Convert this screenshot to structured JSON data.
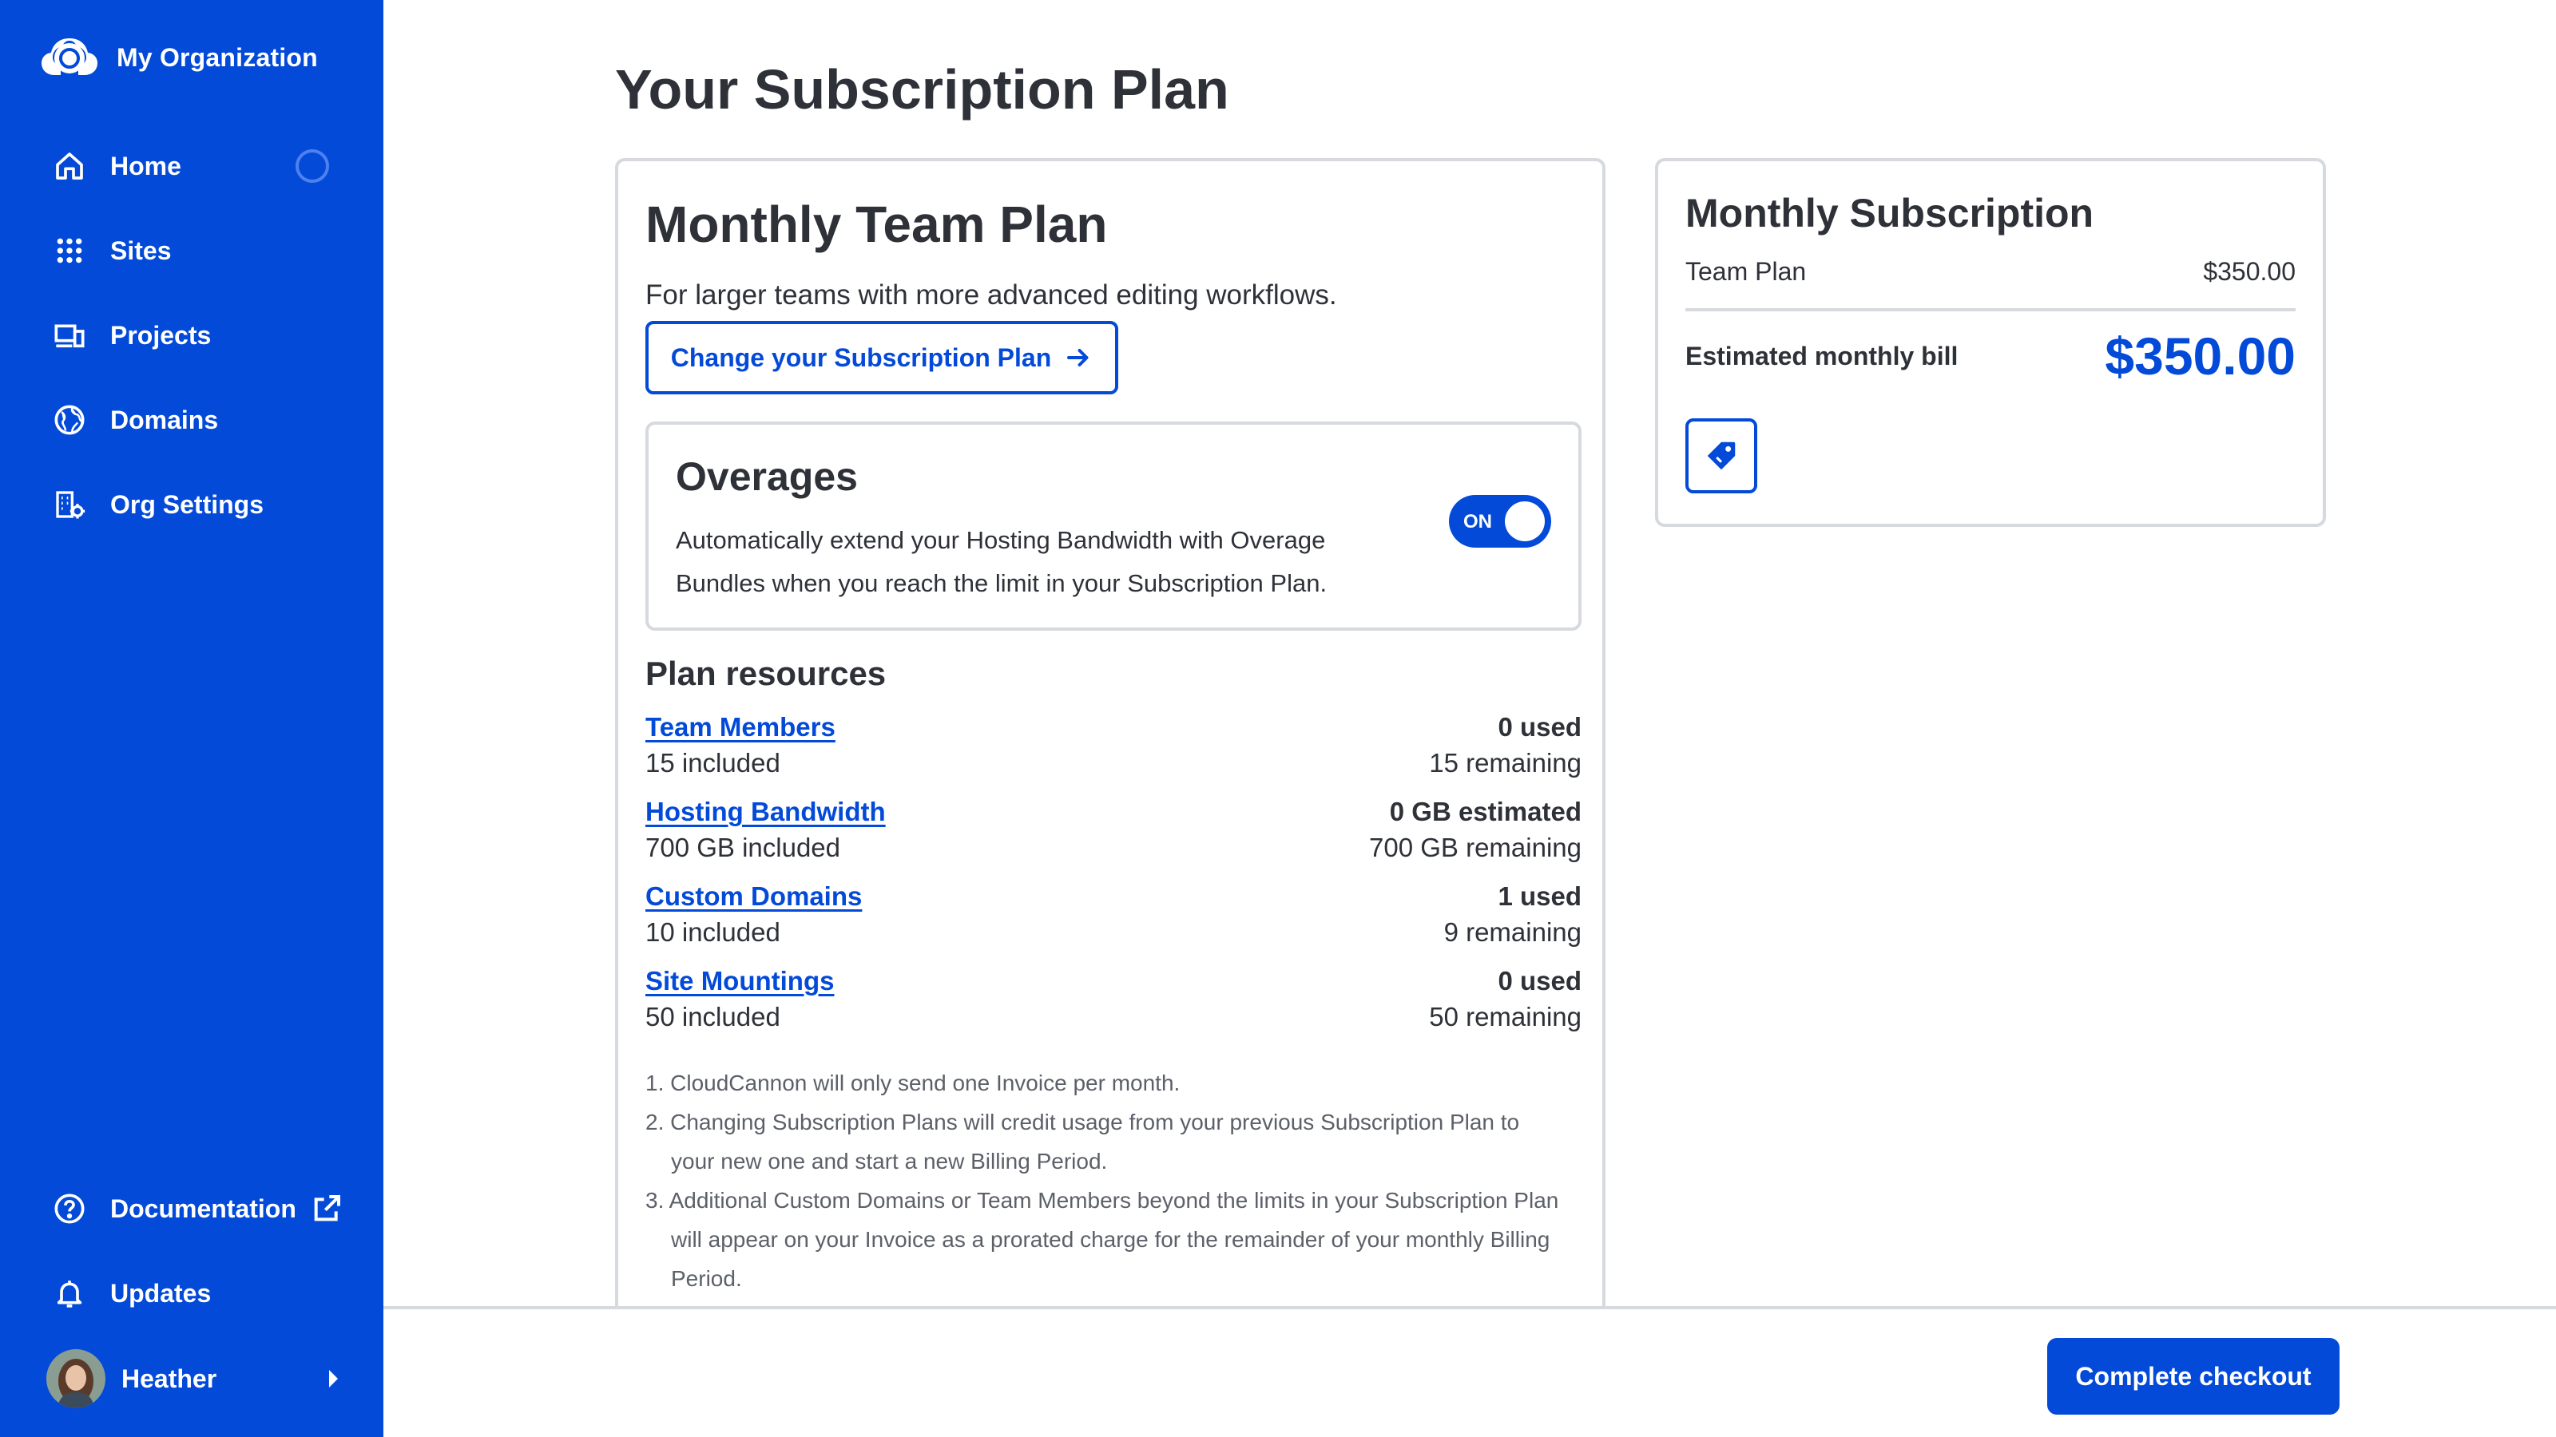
{
  "sidebar": {
    "org_name": "My Organization",
    "items": [
      {
        "label": "Home",
        "icon": "home-icon"
      },
      {
        "label": "Sites",
        "icon": "grid-icon"
      },
      {
        "label": "Projects",
        "icon": "devices-icon"
      },
      {
        "label": "Domains",
        "icon": "globe-icon"
      },
      {
        "label": "Org Settings",
        "icon": "building-gear-icon"
      }
    ],
    "bottom_items": [
      {
        "label": "Documentation",
        "icon": "help-circle-icon"
      },
      {
        "label": "Updates",
        "icon": "bell-icon"
      }
    ],
    "user": {
      "name": "Heather"
    },
    "accent": "#034ad8"
  },
  "page": {
    "title": "Your Subscription Plan"
  },
  "plan": {
    "name": "Monthly Team Plan",
    "description": "For larger teams with more advanced editing workflows.",
    "change_button": "Change your Subscription Plan",
    "overages": {
      "title": "Overages",
      "text": "Automatically extend your Hosting Bandwidth with Overage Bundles when you reach the limit in your Subscription Plan.",
      "toggle_label": "ON",
      "enabled": true
    },
    "resources_title": "Plan resources",
    "resources": [
      {
        "name": "Team Members",
        "included": "15 included",
        "used": "0 used",
        "remaining": "15 remaining"
      },
      {
        "name": "Hosting Bandwidth",
        "included": "700 GB included",
        "used": "0 GB estimated",
        "remaining": "700 GB remaining"
      },
      {
        "name": "Custom Domains",
        "included": "10 included",
        "used": "1 used",
        "remaining": "9 remaining"
      },
      {
        "name": "Site Mountings",
        "included": "50 included",
        "used": "0 used",
        "remaining": "50 remaining"
      }
    ],
    "notes": [
      "1. CloudCannon will only send one Invoice per month.",
      "2. Changing Subscription Plans will credit usage from your previous Subscription Plan to your new one and start a new Billing Period.",
      "3. Additional Custom Domains or Team Members beyond the limits in your Subscription Plan will appear on your Invoice as a prorated charge for the remainder of your monthly Billing Period."
    ]
  },
  "subscription": {
    "title": "Monthly Subscription",
    "line_item": "Team Plan",
    "line_price": "$350.00",
    "bill_label": "Estimated monthly bill",
    "bill_value": "$350.00",
    "coupon_icon": "tag-icon"
  },
  "footer": {
    "checkout_button": "Complete checkout"
  }
}
